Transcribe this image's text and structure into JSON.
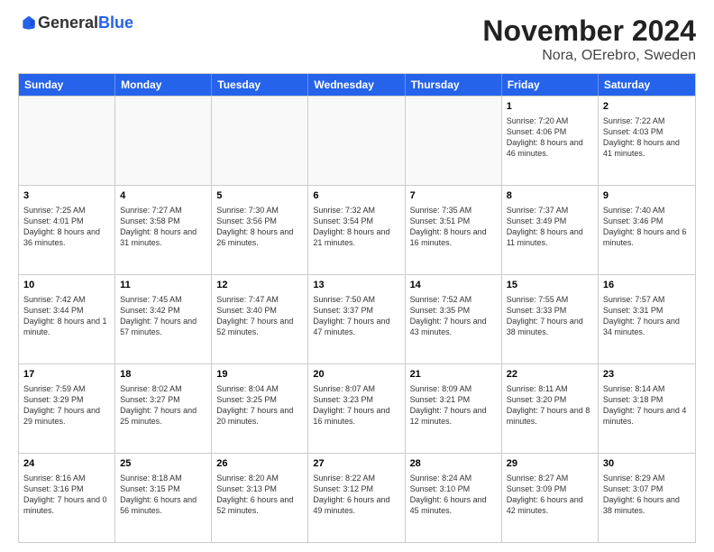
{
  "logo": {
    "general": "General",
    "blue": "Blue"
  },
  "title": "November 2024",
  "location": "Nora, OErebro, Sweden",
  "header_days": [
    "Sunday",
    "Monday",
    "Tuesday",
    "Wednesday",
    "Thursday",
    "Friday",
    "Saturday"
  ],
  "weeks": [
    [
      {
        "day": "",
        "empty": true,
        "text": ""
      },
      {
        "day": "",
        "empty": true,
        "text": ""
      },
      {
        "day": "",
        "empty": true,
        "text": ""
      },
      {
        "day": "",
        "empty": true,
        "text": ""
      },
      {
        "day": "",
        "empty": true,
        "text": ""
      },
      {
        "day": "1",
        "empty": false,
        "text": "Sunrise: 7:20 AM\nSunset: 4:06 PM\nDaylight: 8 hours and 46 minutes."
      },
      {
        "day": "2",
        "empty": false,
        "text": "Sunrise: 7:22 AM\nSunset: 4:03 PM\nDaylight: 8 hours and 41 minutes."
      }
    ],
    [
      {
        "day": "3",
        "empty": false,
        "text": "Sunrise: 7:25 AM\nSunset: 4:01 PM\nDaylight: 8 hours and 36 minutes."
      },
      {
        "day": "4",
        "empty": false,
        "text": "Sunrise: 7:27 AM\nSunset: 3:58 PM\nDaylight: 8 hours and 31 minutes."
      },
      {
        "day": "5",
        "empty": false,
        "text": "Sunrise: 7:30 AM\nSunset: 3:56 PM\nDaylight: 8 hours and 26 minutes."
      },
      {
        "day": "6",
        "empty": false,
        "text": "Sunrise: 7:32 AM\nSunset: 3:54 PM\nDaylight: 8 hours and 21 minutes."
      },
      {
        "day": "7",
        "empty": false,
        "text": "Sunrise: 7:35 AM\nSunset: 3:51 PM\nDaylight: 8 hours and 16 minutes."
      },
      {
        "day": "8",
        "empty": false,
        "text": "Sunrise: 7:37 AM\nSunset: 3:49 PM\nDaylight: 8 hours and 11 minutes."
      },
      {
        "day": "9",
        "empty": false,
        "text": "Sunrise: 7:40 AM\nSunset: 3:46 PM\nDaylight: 8 hours and 6 minutes."
      }
    ],
    [
      {
        "day": "10",
        "empty": false,
        "text": "Sunrise: 7:42 AM\nSunset: 3:44 PM\nDaylight: 8 hours and 1 minute."
      },
      {
        "day": "11",
        "empty": false,
        "text": "Sunrise: 7:45 AM\nSunset: 3:42 PM\nDaylight: 7 hours and 57 minutes."
      },
      {
        "day": "12",
        "empty": false,
        "text": "Sunrise: 7:47 AM\nSunset: 3:40 PM\nDaylight: 7 hours and 52 minutes."
      },
      {
        "day": "13",
        "empty": false,
        "text": "Sunrise: 7:50 AM\nSunset: 3:37 PM\nDaylight: 7 hours and 47 minutes."
      },
      {
        "day": "14",
        "empty": false,
        "text": "Sunrise: 7:52 AM\nSunset: 3:35 PM\nDaylight: 7 hours and 43 minutes."
      },
      {
        "day": "15",
        "empty": false,
        "text": "Sunrise: 7:55 AM\nSunset: 3:33 PM\nDaylight: 7 hours and 38 minutes."
      },
      {
        "day": "16",
        "empty": false,
        "text": "Sunrise: 7:57 AM\nSunset: 3:31 PM\nDaylight: 7 hours and 34 minutes."
      }
    ],
    [
      {
        "day": "17",
        "empty": false,
        "text": "Sunrise: 7:59 AM\nSunset: 3:29 PM\nDaylight: 7 hours and 29 minutes."
      },
      {
        "day": "18",
        "empty": false,
        "text": "Sunrise: 8:02 AM\nSunset: 3:27 PM\nDaylight: 7 hours and 25 minutes."
      },
      {
        "day": "19",
        "empty": false,
        "text": "Sunrise: 8:04 AM\nSunset: 3:25 PM\nDaylight: 7 hours and 20 minutes."
      },
      {
        "day": "20",
        "empty": false,
        "text": "Sunrise: 8:07 AM\nSunset: 3:23 PM\nDaylight: 7 hours and 16 minutes."
      },
      {
        "day": "21",
        "empty": false,
        "text": "Sunrise: 8:09 AM\nSunset: 3:21 PM\nDaylight: 7 hours and 12 minutes."
      },
      {
        "day": "22",
        "empty": false,
        "text": "Sunrise: 8:11 AM\nSunset: 3:20 PM\nDaylight: 7 hours and 8 minutes."
      },
      {
        "day": "23",
        "empty": false,
        "text": "Sunrise: 8:14 AM\nSunset: 3:18 PM\nDaylight: 7 hours and 4 minutes."
      }
    ],
    [
      {
        "day": "24",
        "empty": false,
        "text": "Sunrise: 8:16 AM\nSunset: 3:16 PM\nDaylight: 7 hours and 0 minutes."
      },
      {
        "day": "25",
        "empty": false,
        "text": "Sunrise: 8:18 AM\nSunset: 3:15 PM\nDaylight: 6 hours and 56 minutes."
      },
      {
        "day": "26",
        "empty": false,
        "text": "Sunrise: 8:20 AM\nSunset: 3:13 PM\nDaylight: 6 hours and 52 minutes."
      },
      {
        "day": "27",
        "empty": false,
        "text": "Sunrise: 8:22 AM\nSunset: 3:12 PM\nDaylight: 6 hours and 49 minutes."
      },
      {
        "day": "28",
        "empty": false,
        "text": "Sunrise: 8:24 AM\nSunset: 3:10 PM\nDaylight: 6 hours and 45 minutes."
      },
      {
        "day": "29",
        "empty": false,
        "text": "Sunrise: 8:27 AM\nSunset: 3:09 PM\nDaylight: 6 hours and 42 minutes."
      },
      {
        "day": "30",
        "empty": false,
        "text": "Sunrise: 8:29 AM\nSunset: 3:07 PM\nDaylight: 6 hours and 38 minutes."
      }
    ]
  ]
}
